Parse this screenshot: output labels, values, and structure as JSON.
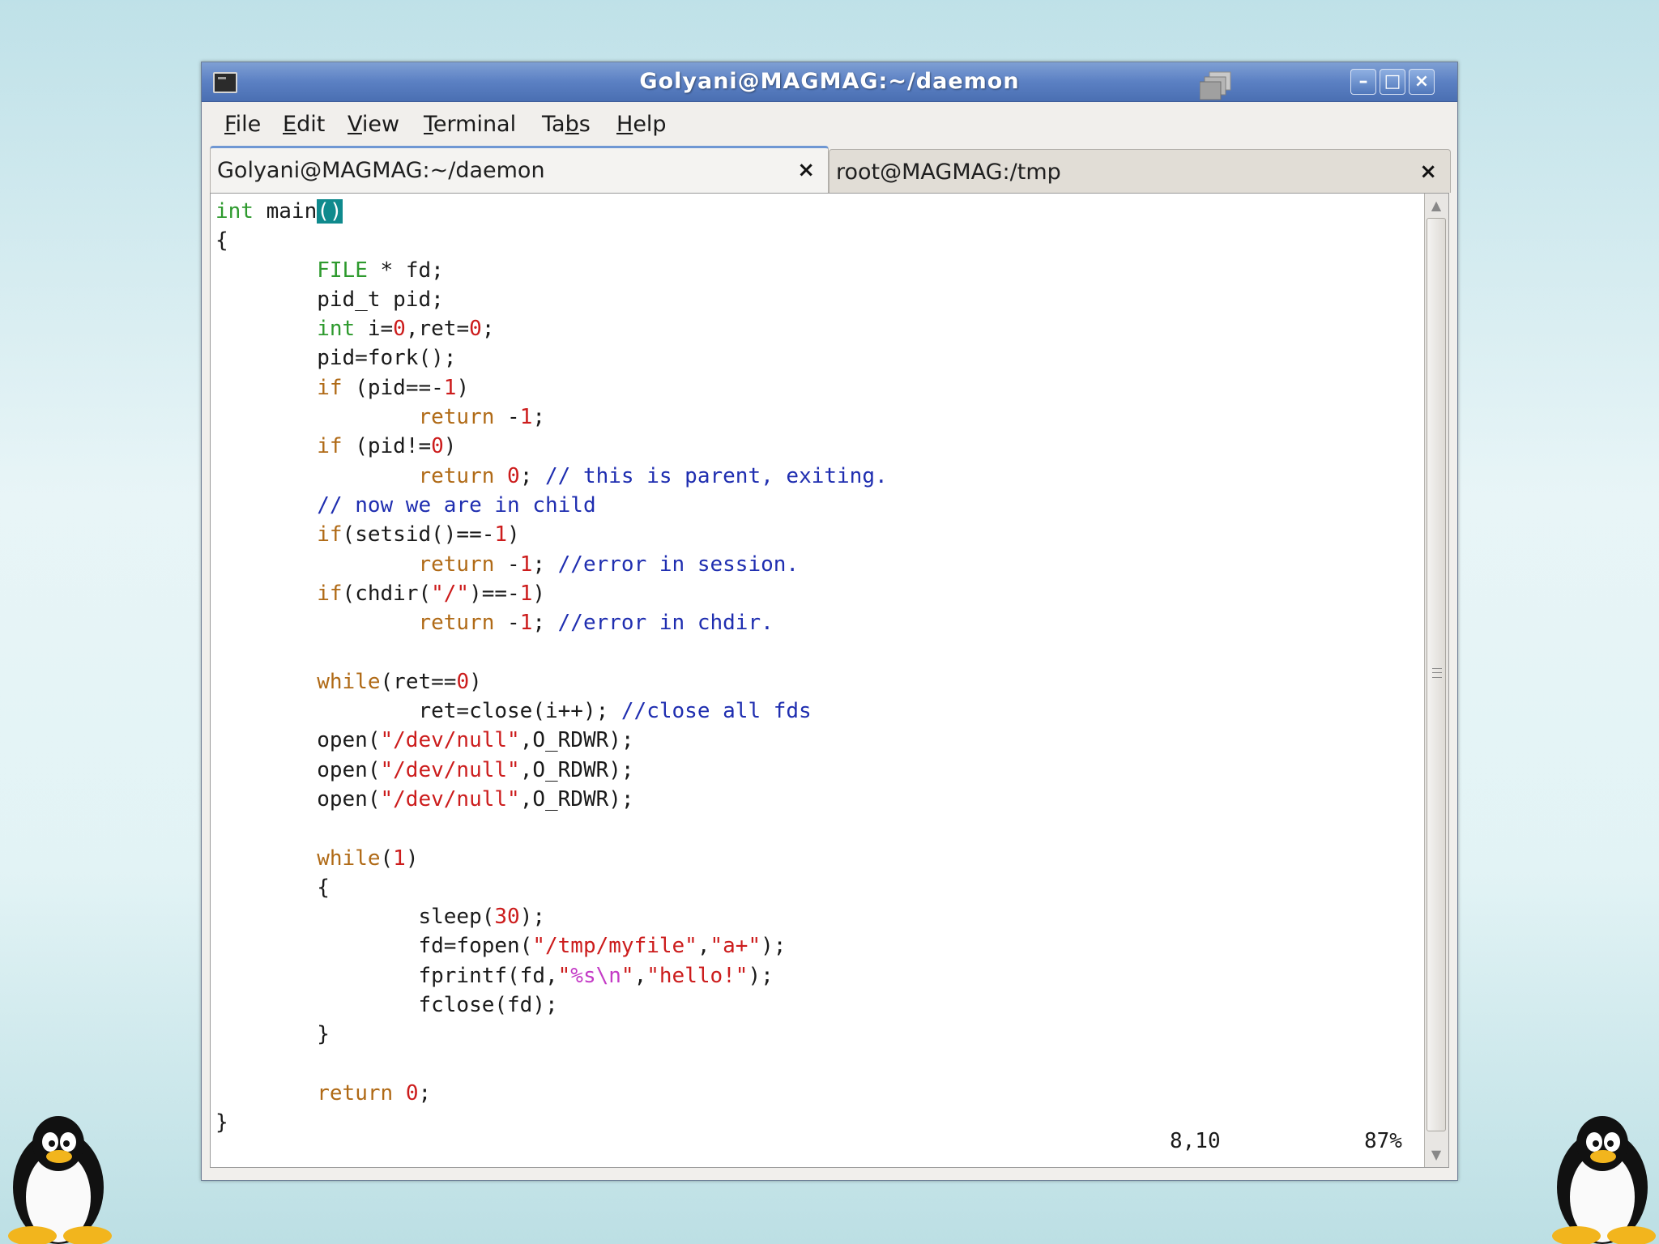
{
  "window": {
    "title": "Golyani@MAGMAG:~/daemon",
    "controls": {
      "minimize": "–",
      "maximize": "□",
      "close": "×"
    }
  },
  "menu": [
    {
      "label": "File"
    },
    {
      "label": "Edit"
    },
    {
      "label": "View"
    },
    {
      "label": "Terminal"
    },
    {
      "label": "Tabs"
    },
    {
      "label": "Help"
    }
  ],
  "tabs": [
    {
      "label": "Golyani@MAGMAG:~/daemon",
      "active": true,
      "close": "×"
    },
    {
      "label": "root@MAGMAG:/tmp",
      "active": false,
      "close": "×"
    }
  ],
  "code_lines": [
    "int main()",
    "{",
    "        FILE * fd;",
    "        pid_t pid;",
    "        int i=0,ret=0;",
    "        pid=fork();",
    "        if (pid==-1)",
    "                return -1;",
    "        if (pid!=0)",
    "                return 0; // this is parent, exiting.",
    "        // now we are in child",
    "        if(setsid()==-1)",
    "                return -1; //error in session.",
    "        if(chdir(\"/\")==-1)",
    "                return -1; //error in chdir.",
    "",
    "        while(ret==0)",
    "                ret=close(i++); //close all fds",
    "        open(\"/dev/null\",O_RDWR);",
    "        open(\"/dev/null\",O_RDWR);",
    "        open(\"/dev/null\",O_RDWR);",
    "",
    "        while(1)",
    "        {",
    "                sleep(30);",
    "                fd=fopen(\"/tmp/myfile\",\"a+\");",
    "                fprintf(fd,\"%s\\n\",\"hello!\");",
    "                fclose(fd);",
    "        }",
    "",
    "        return 0;",
    "}"
  ],
  "status": {
    "position": "8,10",
    "percent": "87%"
  },
  "colors": {
    "type": "#2e9a2e",
    "keyword": "#b06a16",
    "number": "#cc1c1c",
    "string": "#cc1c1c",
    "comment": "#1f2eb0",
    "escape": "#c43bc6",
    "cursor": "#0f8a8d"
  },
  "icons": [
    "terminal-app-icon",
    "workspace-stack-icon",
    "minimize-icon",
    "maximize-icon",
    "close-icon",
    "tab-close-icon",
    "scroll-up-arrow-icon",
    "scroll-down-arrow-icon",
    "tux-penguin-icon"
  ]
}
